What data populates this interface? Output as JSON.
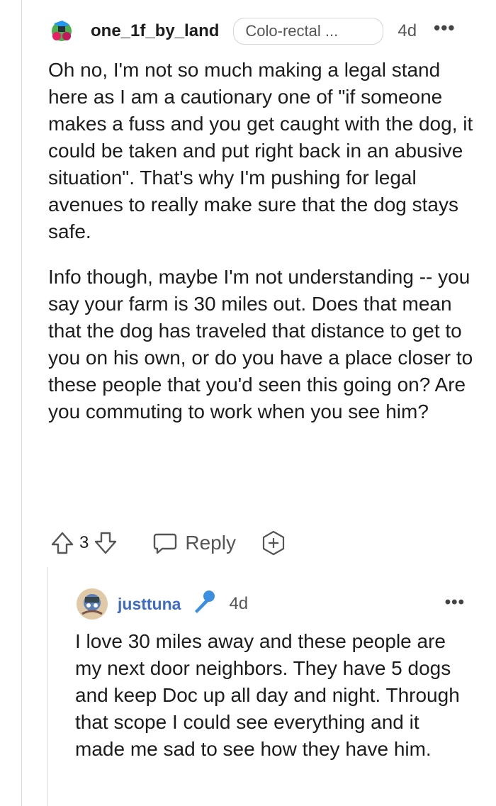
{
  "comment": {
    "username": "one_1f_by_land",
    "flair": "Colo-rectal ...",
    "time": "4d",
    "more": "•••",
    "paragraphs": [
      "Oh no, I'm not so much making a legal stand here as I am a cautionary one of \"if someone makes a fuss and you get caught with the dog, it could be taken and put right back in an abusive situation\". That's why I'm pushing for legal avenues to really make sure that the dog stays safe.",
      "Info though, maybe I'm not understanding -- you say your farm is 30 miles out. Does that mean that the dog has traveled that distance to get to you on his own, or do you have a place closer to these people that you'd seen this going on? Are you commuting to work when you see him?"
    ],
    "actions": {
      "vote_count": "3",
      "reply_label": "Reply",
      "icons": [
        "upvote-icon",
        "downvote-icon",
        "reply-bubble-icon",
        "award-icon"
      ]
    }
  },
  "reply": {
    "username": "justtuna",
    "time": "4d",
    "more": "•••",
    "badge_icon": "microphone-icon",
    "text": "I love 30 miles away and these people are my next door neighbors. They have 5 dogs and keep Doc up all day and night. Through that scope I could see everything and it made me sad to see how they have him."
  },
  "colors": {
    "username_link": "#3e6cc4",
    "mic_badge": "#3b8fe0",
    "thread_line": "#dcdcdc"
  }
}
